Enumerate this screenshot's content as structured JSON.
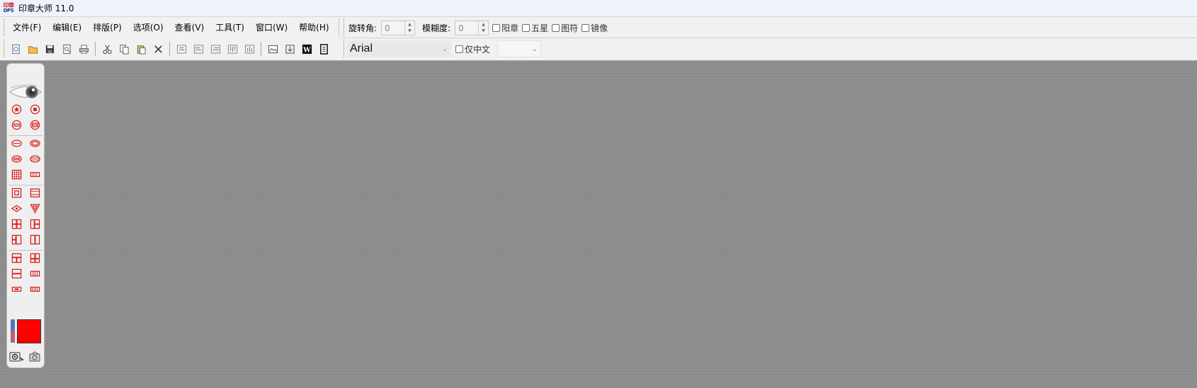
{
  "window": {
    "title": "印章大师 11.0",
    "icon_text_top": "印章",
    "icon_text_bottom": "DPS"
  },
  "menu": [
    {
      "id": "file",
      "label": "文件(F)"
    },
    {
      "id": "edit",
      "label": "编辑(E)"
    },
    {
      "id": "layout",
      "label": "排版(P)"
    },
    {
      "id": "options",
      "label": "选项(O)"
    },
    {
      "id": "view",
      "label": "查看(V)"
    },
    {
      "id": "tools",
      "label": "工具(T)"
    },
    {
      "id": "window",
      "label": "窗口(W)"
    },
    {
      "id": "help",
      "label": "帮助(H)"
    }
  ],
  "props": {
    "rotation_label": "旋转角:",
    "rotation_value": "0",
    "blur_label": "模糊度:",
    "blur_value": "0",
    "checkboxes": [
      {
        "label": "阳章",
        "checked": false
      },
      {
        "label": "五星",
        "checked": false
      },
      {
        "label": "图符",
        "checked": false
      },
      {
        "label": "镜像",
        "checked": false
      }
    ]
  },
  "font": {
    "name": "Arial",
    "chinese_only_label": "仅中文",
    "chinese_only_checked": false,
    "size": ""
  },
  "toolbar": {
    "groups": [
      [
        "new-icon",
        "open-icon",
        "save-icon",
        "print-preview-icon",
        "print-icon"
      ],
      [
        "cut-icon",
        "copy-icon",
        "paste-icon",
        "delete-icon"
      ],
      [
        "align-center-icon",
        "align-left-icon",
        "align-right-icon",
        "align-top-icon",
        "align-bottom-icon"
      ],
      [
        "insert-image-icon",
        "export-icon",
        "word-icon",
        "more-icon"
      ]
    ]
  },
  "palette": {
    "rows": [
      [
        "circle-star-stamp-icon",
        "circle-seal-stamp-icon"
      ],
      [
        "circle-bar-stamp-icon",
        "circle-double-bar-stamp-icon"
      ],
      [
        "oval-stamp-icon",
        "oval-double-stamp-icon"
      ],
      [
        "oval-bar-stamp-icon",
        "oval-double-bar-stamp-icon"
      ],
      [
        "grid-stamp-icon",
        "rect-strip-stamp-icon"
      ],
      [
        "square-stamp-icon",
        "square-header-stamp-icon"
      ],
      [
        "diamond-stamp-icon",
        "triangle-stamp-icon"
      ],
      [
        "quad-grid-stamp-icon",
        "split-grid-stamp-icon"
      ],
      [
        "left-split-stamp-icon",
        "two-column-stamp-icon"
      ],
      [
        "top-split-stamp-icon",
        "four-panel-stamp-icon"
      ],
      [
        "two-row-stamp-icon",
        "wide-strip-stamp-icon"
      ],
      [
        "small-rect-stamp-icon",
        "multi-cell-stamp-icon"
      ]
    ],
    "current_color": "#ff0000",
    "accent": "#d81a1a"
  }
}
